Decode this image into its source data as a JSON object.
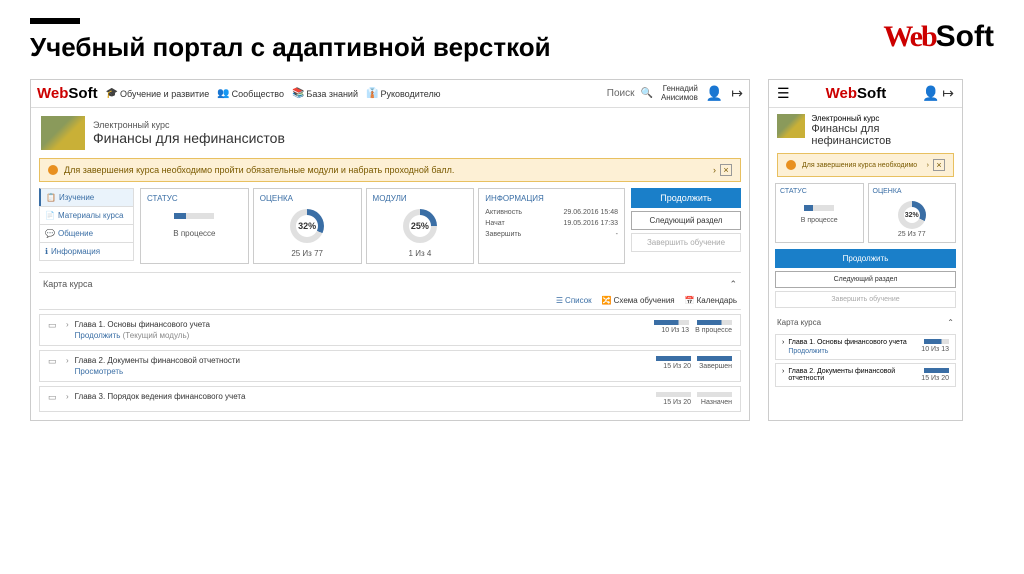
{
  "slide": {
    "title": "Учебный портал с адаптивной версткой",
    "logo_web": "Web",
    "logo_soft": "Soft"
  },
  "nav": {
    "learning": "Обучение и развитие",
    "community": "Сообщество",
    "knowledge": "База знаний",
    "manager": "Руководителю",
    "search_placeholder": "Поиск",
    "user_first": "Геннадий",
    "user_last": "Анисимов"
  },
  "course": {
    "pretitle": "Электронный курс",
    "title": "Финансы для нефинансистов",
    "mobile_title": "Финансы для нефинансистов"
  },
  "alert": {
    "text": "Для завершения курса необходимо пройти обязательные модули и набрать проходной балл.",
    "text_mobile": "Для завершения курса необходимо",
    "close": "×"
  },
  "sidebar": {
    "study": "Изучение",
    "materials": "Материалы курса",
    "chat": "Общение",
    "info": "Информация"
  },
  "stats": {
    "status_label": "СТАТУС",
    "status_value": "В процессе",
    "score_label": "ОЦЕНКА",
    "score_percent": "32%",
    "score_footer": "25 Из 77",
    "modules_label": "МОДУЛИ",
    "modules_percent": "25%",
    "modules_footer": "1 Из 4",
    "info_label": "ИНФОРМАЦИЯ",
    "activity_label": "Активность",
    "activity_value": "29.06.2016 15:48",
    "started_label": "Начат",
    "started_value": "19.05.2016 17:33",
    "finish_label": "Завершить",
    "finish_value": "-"
  },
  "actions": {
    "continue": "Продолжить",
    "next": "Следующий раздел",
    "finish": "Завершить обучение"
  },
  "coursemap": {
    "title": "Карта курса",
    "tab_list": "Список",
    "tab_scheme": "Схема обучения",
    "tab_calendar": "Календарь"
  },
  "chapters": [
    {
      "title": "Глава 1. Основы финансового учета",
      "link": "Продолжить",
      "link_note": "(Текущий модуль)",
      "score": "10 Из 13",
      "status": "В процессе"
    },
    {
      "title": "Глава 2. Документы финансовой отчетности",
      "link": "Просмотреть",
      "score": "15 Из 20",
      "status": "Завершен"
    },
    {
      "title": "Глава 3. Порядок ведения финансового учета",
      "link": "",
      "score": "15 Из 20",
      "status": "Назначен"
    }
  ],
  "mobile_chapters": [
    {
      "title": "Глава 1. Основы финансового учета",
      "link": "Продолжить",
      "score": "10 Из 13"
    },
    {
      "title": "Глава 2. Документы финансовой отчетности",
      "score": "15 Из 20"
    }
  ]
}
